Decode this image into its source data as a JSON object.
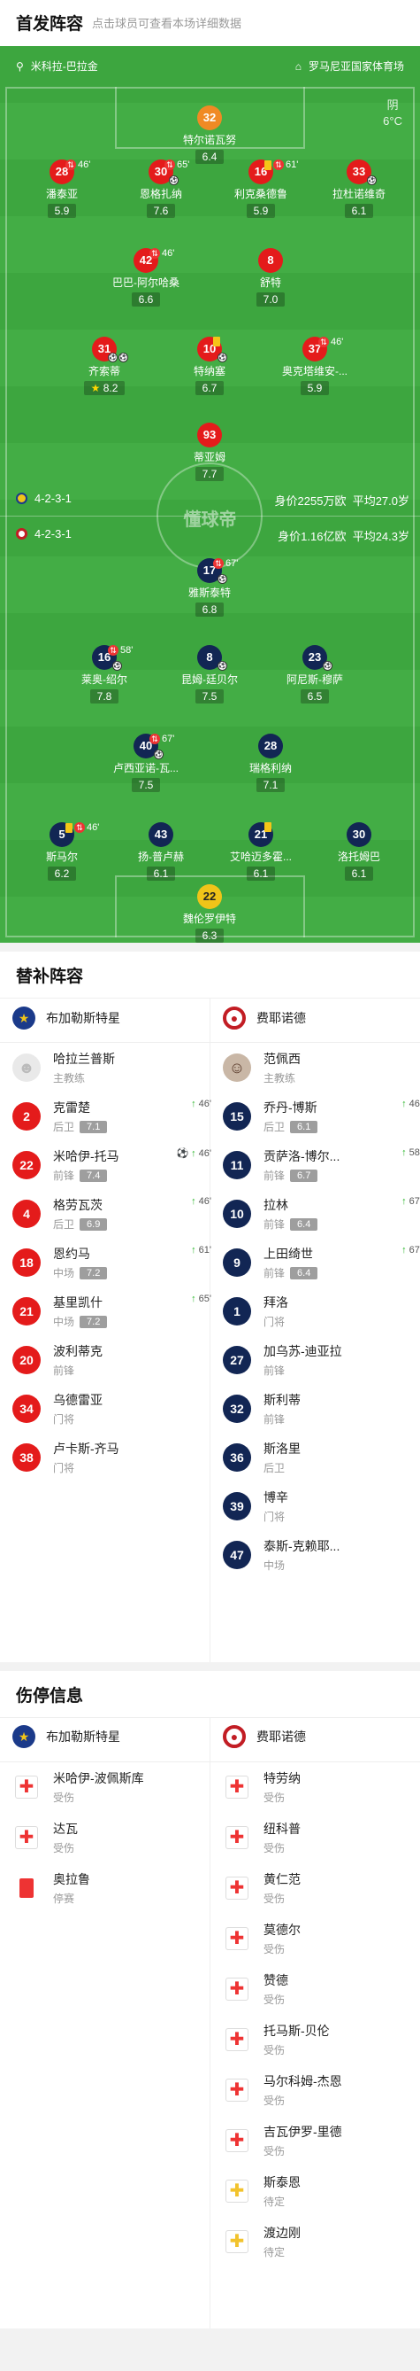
{
  "header": {
    "title": "首发阵容",
    "subtitle": "点击球员可查看本场详细数据"
  },
  "pitch": {
    "home_team_label": "米科拉-巴拉金",
    "away_team_label": "罗马尼亚国家体育场",
    "weather_label": "阴",
    "temperature": "6°C",
    "watermark": "懂球帝",
    "home": {
      "formation": "4-2-3-1",
      "value": "身价2255万欧",
      "age": "平均27.0岁"
    },
    "away": {
      "formation": "4-2-3-1",
      "value": "身价1.16亿欧",
      "age": "平均24.3岁"
    }
  },
  "players": [
    {
      "no": "32",
      "name": "特尔诺瓦努",
      "rating": "6.4",
      "kit": "orange"
    },
    {
      "no": "28",
      "name": "潘泰亚",
      "rating": "5.9",
      "kit": "red",
      "sub": "46'"
    },
    {
      "no": "30",
      "name": "恩格扎纳",
      "rating": "7.6",
      "kit": "red",
      "sub": "65'",
      "goal": true
    },
    {
      "no": "16",
      "name": "利克桑德鲁",
      "rating": "5.9",
      "kit": "red",
      "card": true,
      "sub": "61'"
    },
    {
      "no": "33",
      "name": "拉杜诺维奇",
      "rating": "6.1",
      "kit": "red",
      "ball": true
    },
    {
      "no": "42",
      "name": "巴巴-阿尔哈桑",
      "rating": "6.6",
      "kit": "red",
      "sub": "46'"
    },
    {
      "no": "8",
      "name": "舒特",
      "rating": "7.0",
      "kit": "red"
    },
    {
      "no": "31",
      "name": "齐索蒂",
      "rating": "8.2",
      "kit": "red",
      "goal2": true,
      "star": true
    },
    {
      "no": "10",
      "name": "特纳塞",
      "rating": "6.7",
      "kit": "red",
      "card": true,
      "goal": true
    },
    {
      "no": "37",
      "name": "奥克塔维安-...",
      "rating": "5.9",
      "kit": "red",
      "sub": "46'"
    },
    {
      "no": "93",
      "name": "蒂亚姆",
      "rating": "7.7",
      "kit": "red"
    },
    {
      "no": "17",
      "name": "雅斯泰特",
      "rating": "6.8",
      "kit": "navy",
      "sub": "67'",
      "goal": true
    },
    {
      "no": "16",
      "name": "莱奥-绍尔",
      "rating": "7.8",
      "kit": "navy",
      "sub": "58'",
      "goal": true
    },
    {
      "no": "8",
      "name": "昆姆-廷贝尔",
      "rating": "7.5",
      "kit": "navy",
      "ball": true
    },
    {
      "no": "23",
      "name": "阿尼斯-穆萨",
      "rating": "6.5",
      "kit": "navy",
      "goal": true
    },
    {
      "no": "40",
      "name": "卢西亚诺-瓦...",
      "rating": "7.5",
      "kit": "navy",
      "sub": "67'",
      "goal": true
    },
    {
      "no": "28",
      "name": "瑞格利纳",
      "rating": "7.1",
      "kit": "navy"
    },
    {
      "no": "5",
      "name": "斯马尔",
      "rating": "6.2",
      "kit": "navy",
      "card": true,
      "sub": "46'"
    },
    {
      "no": "43",
      "name": "扬-普卢赫",
      "rating": "6.1",
      "kit": "navy"
    },
    {
      "no": "21",
      "name": "艾哈迈多霍...",
      "rating": "6.1",
      "kit": "navy",
      "card": true
    },
    {
      "no": "30",
      "name": "洛托姆巴",
      "rating": "6.1",
      "kit": "navy"
    },
    {
      "no": "22",
      "name": "魏伦罗伊特",
      "rating": "6.3",
      "kit": "yellowk"
    }
  ],
  "subs": {
    "title": "替补阵容",
    "home_team": "布加勒斯特星",
    "away_team": "费耶诺德",
    "home_coach": {
      "name": "哈拉兰普斯",
      "role": "主教练"
    },
    "away_coach": {
      "name": "范佩西",
      "role": "主教练"
    },
    "home": [
      {
        "no": "2",
        "name": "克雷楚",
        "pos": "后卫",
        "rating": "7.1",
        "ev": "46'"
      },
      {
        "no": "22",
        "name": "米哈伊-托马",
        "pos": "前锋",
        "rating": "7.4",
        "ev": "46'",
        "goal": true
      },
      {
        "no": "4",
        "name": "格劳瓦茨",
        "pos": "后卫",
        "rating": "6.9",
        "ev": "46'"
      },
      {
        "no": "18",
        "name": "恩约马",
        "pos": "中场",
        "rating": "7.2",
        "ev": "61'"
      },
      {
        "no": "21",
        "name": "基里凯什",
        "pos": "中场",
        "rating": "7.2",
        "ev": "65'"
      },
      {
        "no": "20",
        "name": "波利蒂克",
        "pos": "前锋"
      },
      {
        "no": "34",
        "name": "乌德雷亚",
        "pos": "门将"
      },
      {
        "no": "38",
        "name": "卢卡斯-齐马",
        "pos": "门将"
      }
    ],
    "away": [
      {
        "no": "15",
        "name": "乔丹-博斯",
        "pos": "后卫",
        "rating": "6.1",
        "ev": "46'"
      },
      {
        "no": "11",
        "name": "贡萨洛-博尔...",
        "pos": "前锋",
        "rating": "6.7",
        "ev": "58'"
      },
      {
        "no": "10",
        "name": "拉林",
        "pos": "前锋",
        "rating": "6.4",
        "ev": "67'"
      },
      {
        "no": "9",
        "name": "上田绮世",
        "pos": "前锋",
        "rating": "6.4",
        "ev": "67'"
      },
      {
        "no": "1",
        "name": "拜洛",
        "pos": "门将"
      },
      {
        "no": "27",
        "name": "加乌苏-迪亚拉",
        "pos": "前锋"
      },
      {
        "no": "32",
        "name": "斯利蒂",
        "pos": "前锋"
      },
      {
        "no": "36",
        "name": "斯洛里",
        "pos": "后卫"
      },
      {
        "no": "39",
        "name": "博辛",
        "pos": "门将"
      },
      {
        "no": "47",
        "name": "泰斯-克赖耶...",
        "pos": "中场"
      }
    ]
  },
  "injuries": {
    "title": "伤停信息",
    "home_team": "布加勒斯特星",
    "away_team": "费耶诺德",
    "home": [
      {
        "name": "米哈伊-波佩斯库",
        "status": "受伤",
        "type": "injury"
      },
      {
        "name": "达瓦",
        "status": "受伤",
        "type": "injury"
      },
      {
        "name": "奥拉鲁",
        "status": "停赛",
        "type": "suspension"
      }
    ],
    "away": [
      {
        "name": "特劳纳",
        "status": "受伤",
        "type": "injury"
      },
      {
        "name": "纽科普",
        "status": "受伤",
        "type": "injury"
      },
      {
        "name": "黄仁范",
        "status": "受伤",
        "type": "injury"
      },
      {
        "name": "莫德尔",
        "status": "受伤",
        "type": "injury"
      },
      {
        "name": "赞德",
        "status": "受伤",
        "type": "injury"
      },
      {
        "name": "托马斯-贝伦",
        "status": "受伤",
        "type": "injury"
      },
      {
        "name": "马尔科姆-杰恩",
        "status": "受伤",
        "type": "injury"
      },
      {
        "name": "吉瓦伊罗-里德",
        "status": "受伤",
        "type": "injury"
      },
      {
        "name": "斯泰恩",
        "status": "待定",
        "type": "doubt"
      },
      {
        "name": "渡边刚",
        "status": "待定",
        "type": "doubt"
      }
    ]
  }
}
